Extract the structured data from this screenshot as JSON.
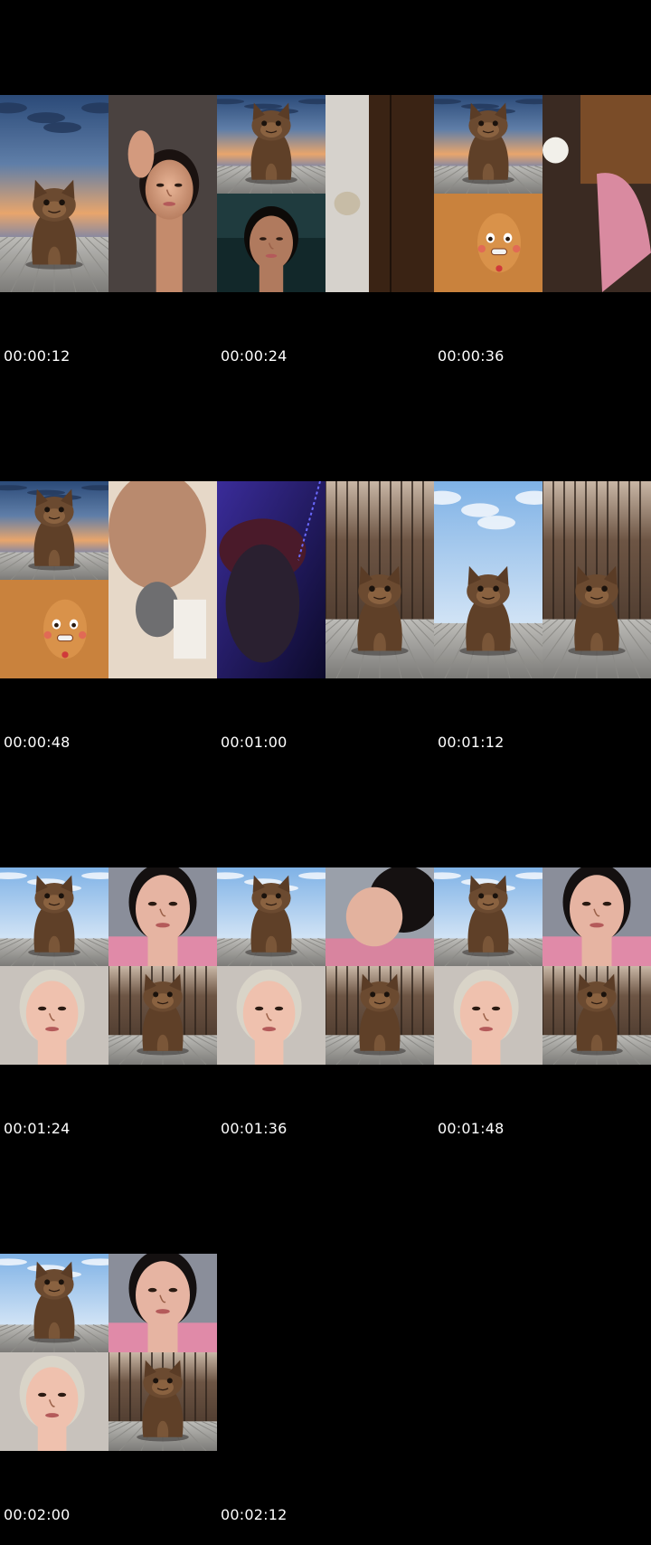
{
  "timestamps": [
    "00:00:12",
    "00:00:24",
    "00:00:36",
    "00:00:48",
    "00:01:00",
    "00:01:12",
    "00:01:24",
    "00:01:36",
    "00:01:48",
    "00:02:00",
    "00:02:12"
  ],
  "frames": [
    {
      "layout": "full",
      "tiles": [
        {
          "scene": "cat-sunset"
        },
        {
          "scene": "woman-selfie"
        },
        {
          "scene": "wood-ceiling"
        }
      ]
    },
    {
      "layout": "split",
      "tiles": [
        {
          "scene": "cat-sunset"
        },
        {
          "scene": "woman-dark"
        },
        {
          "scene": "wood-room"
        }
      ]
    },
    {
      "layout": "split",
      "tiles": [
        {
          "scene": "cat-sunset"
        },
        {
          "scene": "gingerbread"
        },
        {
          "scene": "blurry-room"
        }
      ]
    },
    {
      "layout": "split",
      "tiles": [
        {
          "scene": "cat-sunset"
        },
        {
          "scene": "gingerbread"
        },
        {
          "scene": "finger-blur"
        }
      ]
    },
    {
      "layout": "full",
      "tiles": [
        {
          "scene": "man-purple"
        },
        {
          "scene": "cat-woodwall"
        },
        {
          "scene": "man-cap"
        },
        {
          "scene": "cat-woodwall"
        }
      ]
    },
    {
      "layout": "full",
      "tiles": [
        {
          "scene": "cat-sky"
        },
        {
          "scene": "cat-woodwall"
        }
      ]
    },
    {
      "layout": "quad",
      "tiles": [
        {
          "scene": "cat-sky"
        },
        {
          "scene": "woman-pink"
        },
        {
          "scene": "blonde"
        },
        {
          "scene": "cat-woodwall"
        }
      ]
    },
    {
      "layout": "quad",
      "tiles": [
        {
          "scene": "cat-sky"
        },
        {
          "scene": "woman-profile"
        },
        {
          "scene": "blonde"
        },
        {
          "scene": "cat-woodwall"
        }
      ]
    },
    {
      "layout": "quad",
      "tiles": [
        {
          "scene": "cat-sky"
        },
        {
          "scene": "woman-pink"
        },
        {
          "scene": "blonde"
        },
        {
          "scene": "cat-woodwall"
        }
      ]
    },
    {
      "layout": "quad",
      "tiles": [
        {
          "scene": "cat-sky"
        },
        {
          "scene": "woman-pink"
        },
        {
          "scene": "blonde"
        },
        {
          "scene": "cat-woodwall"
        }
      ]
    }
  ],
  "colors": {
    "background": "#000000",
    "timestamp_text": "#ffffff",
    "cat_body": "#6b4a30",
    "cat_face": "#8a6240",
    "sky_sunset_top": "#2f4f7a",
    "sky_sunset_bottom": "#e9a46a",
    "sky_day": "#9ec4ea",
    "floor": "#a7a6a2",
    "wood": "#6b3e1f",
    "gingerbread": "#c9823d",
    "purple_light": "#2a1f6e"
  }
}
